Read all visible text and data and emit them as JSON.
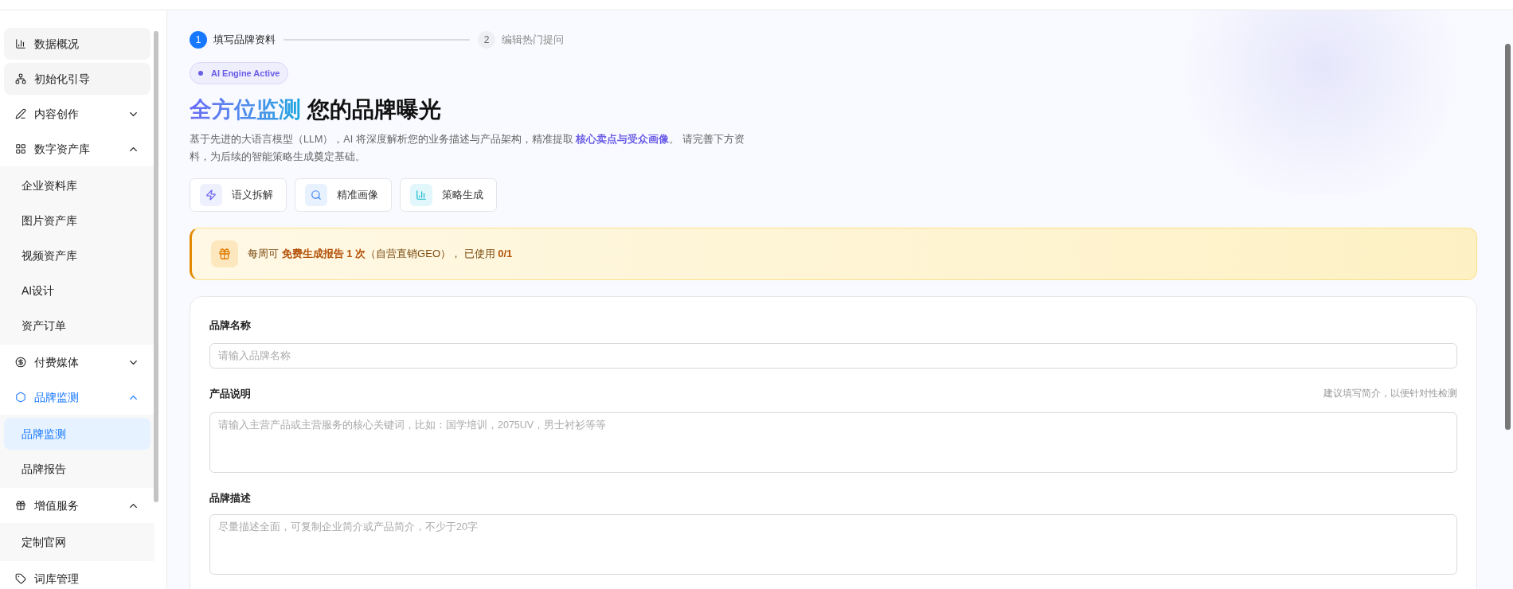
{
  "sidebar": {
    "items": [
      {
        "kind": "link",
        "label": "数据概况"
      },
      {
        "kind": "link",
        "label": "初始化引导"
      },
      {
        "kind": "group",
        "label": "内容创作",
        "expanded": false,
        "active": false
      },
      {
        "kind": "group",
        "label": "数字资产库",
        "expanded": true,
        "active": false,
        "children": [
          {
            "label": "企业资料库",
            "selected": false
          },
          {
            "label": "图片资产库",
            "selected": false
          },
          {
            "label": "视频资产库",
            "selected": false
          },
          {
            "label": "AI设计",
            "selected": false
          },
          {
            "label": "资产订单",
            "selected": false
          }
        ]
      },
      {
        "kind": "group",
        "label": "付费媒体",
        "expanded": false,
        "active": false
      },
      {
        "kind": "group",
        "label": "品牌监测",
        "expanded": true,
        "active": true,
        "children": [
          {
            "label": "品牌监测",
            "selected": true
          },
          {
            "label": "品牌报告",
            "selected": false
          }
        ]
      },
      {
        "kind": "group",
        "label": "增值服务",
        "expanded": true,
        "active": false,
        "children": [
          {
            "label": "定制官网",
            "selected": false
          }
        ]
      },
      {
        "kind": "plain",
        "label": "词库管理"
      }
    ]
  },
  "steps": [
    {
      "number": "1",
      "label": "填写品牌资料",
      "selected": true
    },
    {
      "number": "2",
      "label": "编辑热门提问",
      "selected": false
    }
  ],
  "badge": "AI Engine Active",
  "heading": {
    "highlight": "全方位监测",
    "rest": "您的品牌曝光"
  },
  "description": "基于先进的大语言模型（LLM），AI 将深度解析您的业务描述与产品架构，精准提取 **核心卖点与受众画像**。 请完善下方资料，为后续的智能策略生成奠定基础。",
  "features": [
    {
      "label": "语义拆解"
    },
    {
      "label": "精准画像"
    },
    {
      "label": "策略生成"
    }
  ],
  "notice": "每周可 **免费生成报告 1 次**（自营直销GEO）， 已使用 **0/1**",
  "form": {
    "fields": [
      {
        "kind": "input",
        "label": "品牌名称",
        "placeholder": "请输入品牌名称"
      },
      {
        "kind": "textarea",
        "label": "产品说明",
        "hint": "建议填写简介，以便针对性检测",
        "placeholder": "请输入主营产品或主营服务的核心关键词，比如：国学培训，2075UV，男士衬衫等等"
      },
      {
        "kind": "textarea",
        "label": "品牌描述",
        "placeholder": "尽量描述全面，可复制企业简介或产品简介，不少于20字"
      }
    ]
  }
}
